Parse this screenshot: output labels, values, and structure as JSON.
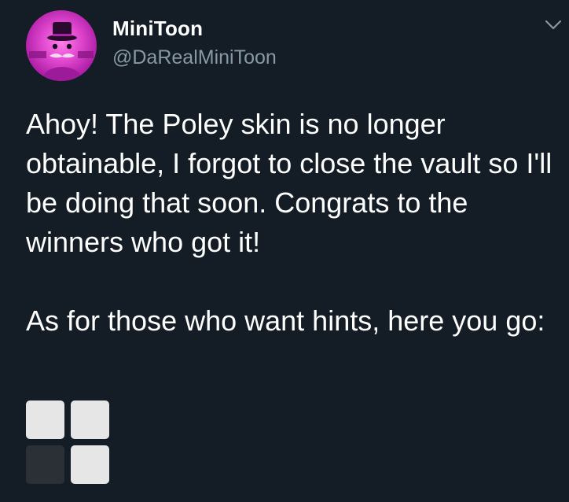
{
  "tweet": {
    "display_name": "MiniToon",
    "handle": "@DaRealMiniToon",
    "avatar_icon": "minitoon-avatar-icon",
    "menu_icon": "chevron-down-icon",
    "text": "Ahoy! The Poley skin is no longer obtainable, I forgot to close the vault so I'll be doing that soon. Congrats to the winners who got it!\n\nAs for those who want hints, here you go:",
    "hint_squares": [
      {
        "name": "hint-square-white-1",
        "color": "#e6e6e6"
      },
      {
        "name": "hint-square-white-2",
        "color": "#e6e6e6"
      },
      {
        "name": "hint-square-black",
        "color": "#2b3037"
      },
      {
        "name": "hint-square-white-3",
        "color": "#e6e6e6"
      }
    ]
  },
  "colors": {
    "background": "#141d26",
    "text": "#ffffff",
    "handle": "#8899a6",
    "avatar": "#e24ad0"
  }
}
